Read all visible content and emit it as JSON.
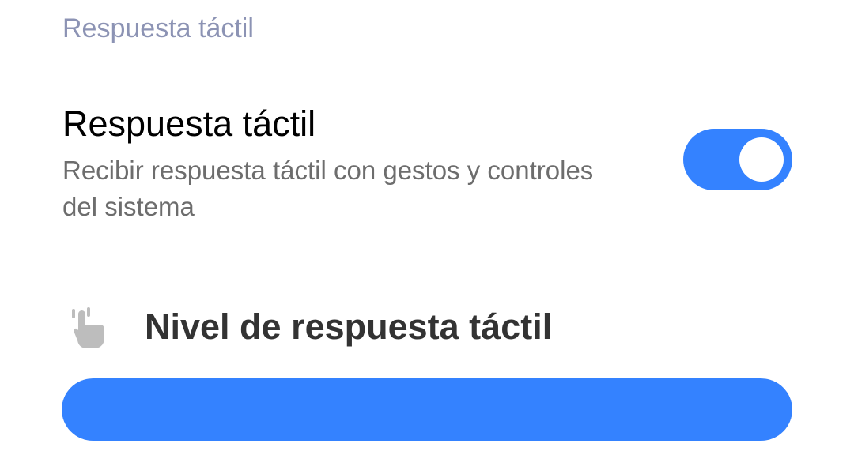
{
  "section": {
    "header": "Respuesta táctil"
  },
  "haptic_toggle": {
    "title": "Respuesta táctil",
    "description": "Recibir respuesta táctil con gestos y controles del sistema",
    "enabled": true
  },
  "haptic_level": {
    "icon": "touch-hand-icon",
    "title": "Nivel de respuesta táctil",
    "value_fraction": 1.0
  },
  "colors": {
    "accent": "#3482ff",
    "section_header": "#8c93b4",
    "track": "#e5e5e5",
    "icon": "#bdbdbd"
  }
}
